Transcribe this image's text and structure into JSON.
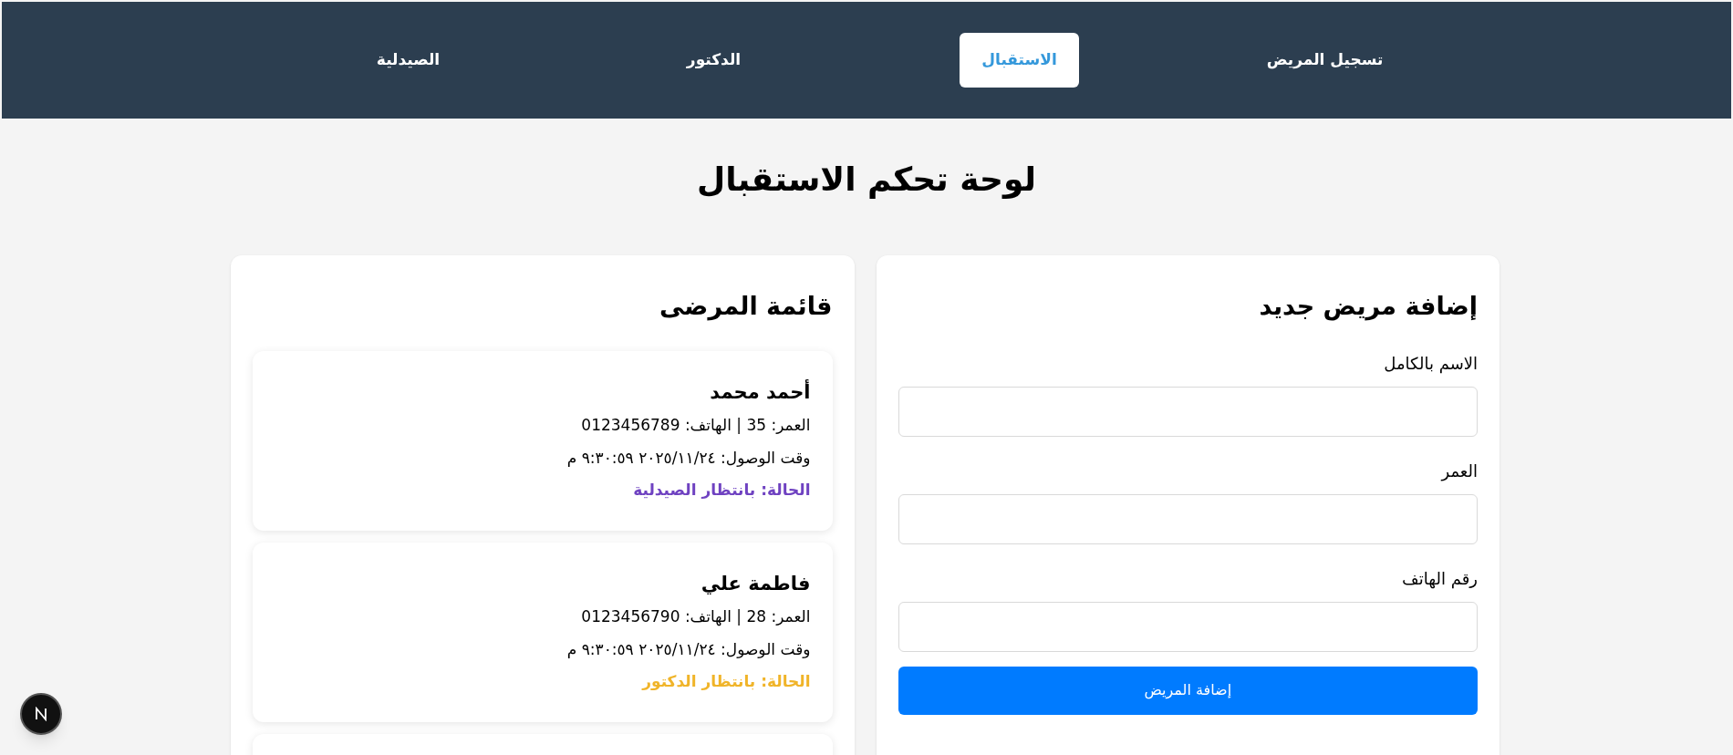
{
  "nav": {
    "items": [
      {
        "label": "تسجيل المريض",
        "selected": false
      },
      {
        "label": "الاستقبال",
        "selected": true
      },
      {
        "label": "الدكتور",
        "selected": false
      },
      {
        "label": "الصيدلية",
        "selected": false
      }
    ]
  },
  "page_title": "لوحة تحكم الاستقبال",
  "form": {
    "title": "إضافة مريض جديد",
    "fields": [
      {
        "label": "الاسم بالكامل"
      },
      {
        "label": "العمر"
      },
      {
        "label": "رقم الهاتف"
      }
    ],
    "submit": "إضافة المريض"
  },
  "patient_list": {
    "title": "قائمة المرضى",
    "patients": [
      {
        "name": "أحمد محمد",
        "details": "العمر: 35 | الهاتف: 0123456789",
        "arrival": "وقت الوصول: ٢٠٢٥/١١/٢٤ ٩:٣٠:٥٩ م",
        "status": "الحالة: بانتظار الصيدلية",
        "color": "#6f42c1"
      },
      {
        "name": "فاطمة علي",
        "details": "العمر: 28 | الهاتف: 0123456790",
        "arrival": "وقت الوصول: ٢٠٢٥/١١/٢٤ ٩:٣٠:٥٩ م",
        "status": "الحالة: بانتظار الدكتور",
        "color": "#f0b429"
      }
    ]
  }
}
